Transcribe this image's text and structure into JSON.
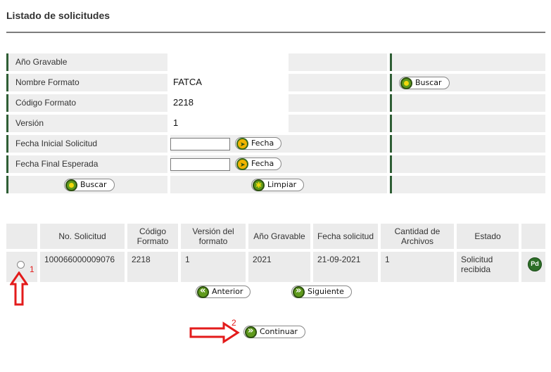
{
  "page": {
    "title": "Listado de solicitudes"
  },
  "form": {
    "fields": [
      {
        "label": "Año Gravable",
        "value": ""
      },
      {
        "label": "Nombre Formato",
        "value": "FATCA"
      },
      {
        "label": "Código Formato",
        "value": "2218"
      },
      {
        "label": "Versión",
        "value": "1"
      },
      {
        "label": "Fecha Inicial Solicitud",
        "value": ""
      },
      {
        "label": "Fecha Final Esperada",
        "value": ""
      }
    ],
    "buscar_side_label": "Buscar",
    "fecha_button_label": "Fecha",
    "buscar_bottom_label": "Buscar",
    "limpiar_label": "Limpiar"
  },
  "table": {
    "headers": [
      "",
      "No. Solicitud",
      "Código Formato",
      "Versión del formato",
      "Año Gravable",
      "Fecha solicitud",
      "Cantidad de Archivos",
      "Estado",
      ""
    ],
    "rows": [
      {
        "no_solicitud": "100066000009076",
        "codigo": "2218",
        "version": "1",
        "anio": "2021",
        "fecha": "21-09-2021",
        "cantidad": "1",
        "estado": "Solicitud recibida",
        "pdf_icon_text": "Pd"
      }
    ]
  },
  "pagination": {
    "anterior_label": "Anterior",
    "siguiente_label": "Siguiente",
    "continuar_label": "Continuar"
  },
  "annotations": {
    "marker_1": "1",
    "marker_2": "2",
    "color": "#e31b1b"
  }
}
